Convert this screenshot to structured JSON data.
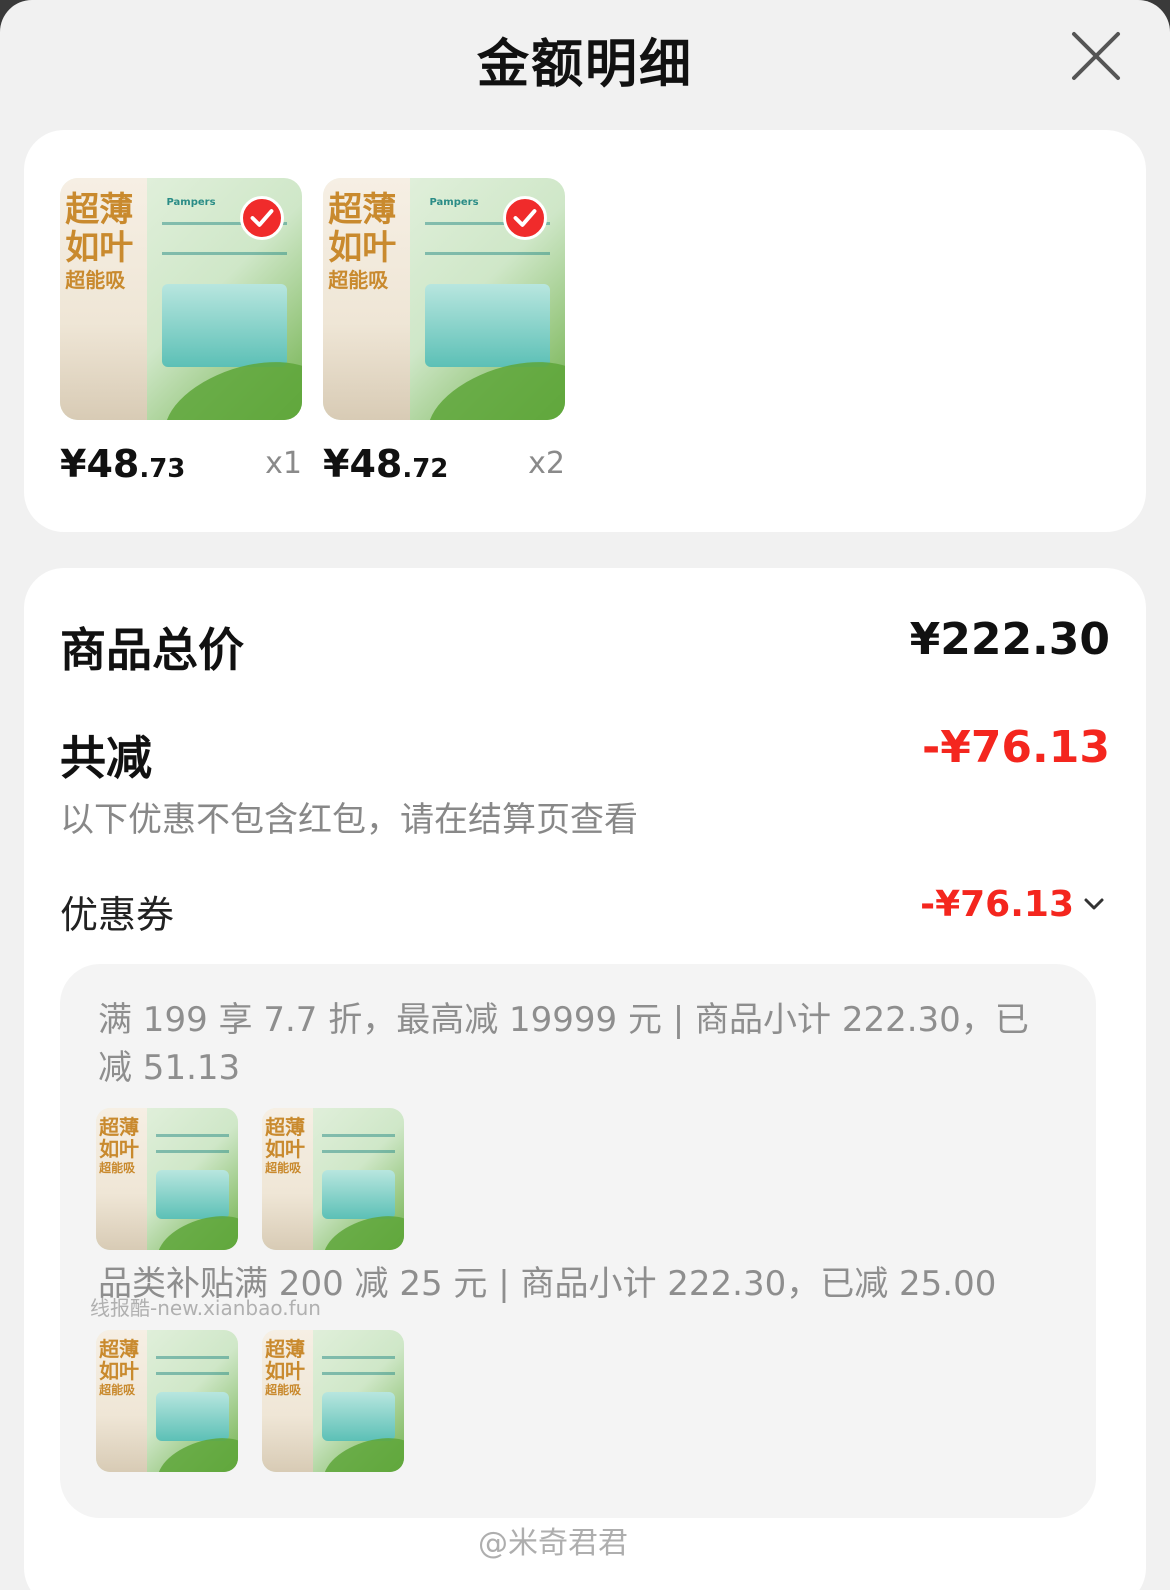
{
  "header": {
    "title": "金额明细"
  },
  "products": [
    {
      "price_int": "¥48",
      "price_dec": ".73",
      "qty": "x1",
      "selected": true
    },
    {
      "price_int": "¥48",
      "price_dec": ".72",
      "qty": "x2",
      "selected": true
    }
  ],
  "product_image_text": {
    "top": "超薄",
    "mid": "如叶",
    "bot": "超能吸",
    "brand": "Pampers"
  },
  "summary": {
    "total_label": "商品总价",
    "total_value": "¥222.30",
    "discount_label": "共减",
    "discount_value": "-¥76.13",
    "note": "以下优惠不包含红包，请在结算页查看",
    "coupon_label": "优惠券",
    "coupon_value": "-¥76.13"
  },
  "rules": [
    {
      "text": "满 199 享 7.7 折，最高减 19999 元 | 商品小计 222.30，已减 51.13"
    },
    {
      "text": "品类补贴满 200 减 25 元 | 商品小计 222.30，已减 25.00"
    }
  ],
  "watermarks": {
    "site": "线报酷-new.xianbao.fun",
    "weibo": "@米奇君君"
  },
  "colors": {
    "accent_red": "#f4261e",
    "check_red": "#f02b2b"
  }
}
